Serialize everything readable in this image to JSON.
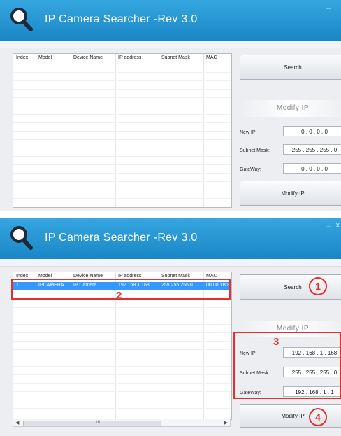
{
  "app_title": "IP Camera Searcher -Rev 3.0",
  "window": {
    "minimize": "–",
    "close": "x"
  },
  "columns": [
    "Index",
    "Model",
    "Device Name",
    "IP address",
    "Subnet Mask",
    "MAC"
  ],
  "buttons": {
    "search": "Search",
    "modify": "Modify IP"
  },
  "modify_section_title": "Modify IP",
  "fields": {
    "new_ip": "New IP:",
    "subnet": "Subnet Mask:",
    "gateway": "GateWay:"
  },
  "screen1": {
    "new_ip": "0  .  0  .  0  .  0",
    "subnet": "255 . 255 . 255 .  0",
    "gateway": "0  .  0  .  0  .  0"
  },
  "screen2": {
    "row": {
      "index": "1",
      "model": "IPCAMERA",
      "device_name": "IP Camera",
      "ip": "192.168.1.168",
      "subnet": "255.255.255.0",
      "mac": "00:00:1B:F"
    },
    "new_ip": "192 . 168 .  1  . 168",
    "subnet": "255 . 255 . 255 .  0",
    "gateway": "192 . 168 .  1  .  1",
    "scroll_grip": "III"
  },
  "annotations": [
    "1",
    "2",
    "3",
    "4"
  ],
  "colors": {
    "titlebar": "#1f8fcf",
    "selection": "#3399ff",
    "annotation": "#e52e2e"
  }
}
